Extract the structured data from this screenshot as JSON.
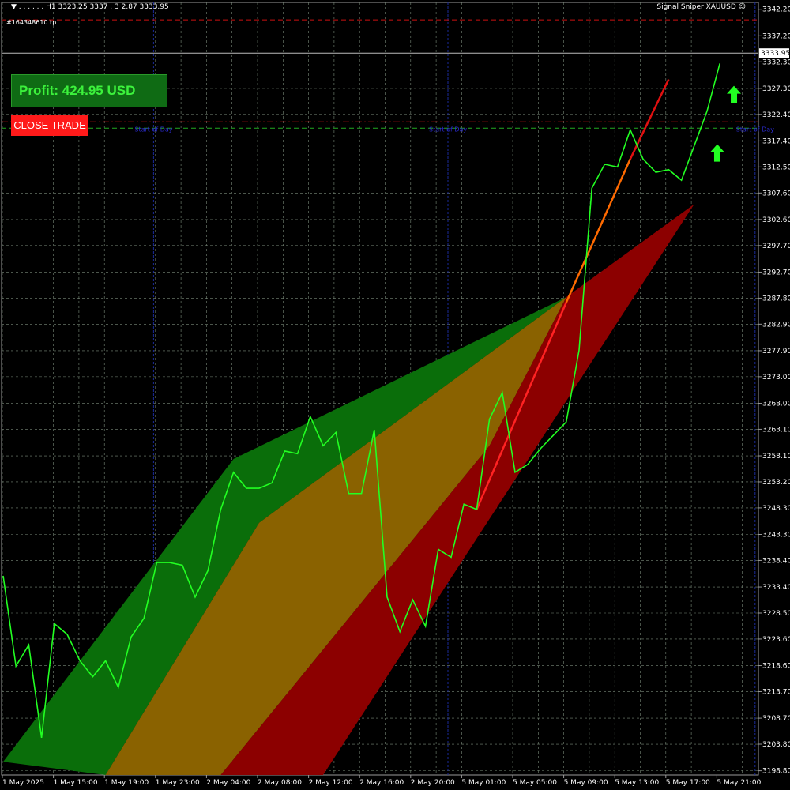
{
  "header": {
    "left": "▼  . . . . . . H1  3323.25 3337 . 3  2.87 3333.95",
    "right": "Signal Sniper XAUUSD ☺"
  },
  "order_label": "#164348610 tp",
  "profit": {
    "label": "Profit: 424.95 USD"
  },
  "close_button": {
    "label": "CLOSE TRADE"
  },
  "current_price": "3333.95",
  "start_of_day_label": "Start of Day",
  "colors": {
    "price_line": "#22ff22",
    "band_green": "#0a6e0a",
    "band_orange": "#8a6200",
    "band_red": "#8c0000",
    "signal_arrow": "#22ff22",
    "tp_line": "#cc1111",
    "grid": "#7a8a7a"
  },
  "chart_data": {
    "type": "line",
    "symbol": "XAUUSD",
    "timeframe": "H1",
    "x_ticks": [
      "1 May 2025",
      "1 May 15:00",
      "1 May 19:00",
      "1 May 23:00",
      "2 May 04:00",
      "2 May 08:00",
      "2 May 12:00",
      "2 May 16:00",
      "2 May 20:00",
      "5 May 01:00",
      "5 May 05:00",
      "5 May 09:00",
      "5 May 13:00",
      "5 May 17:00",
      "5 May 21:00"
    ],
    "y_ticks": [
      "3342.20",
      "3337.20",
      "3332.30",
      "3327.30",
      "3322.40",
      "3317.40",
      "3312.50",
      "3307.60",
      "3302.60",
      "3297.70",
      "3292.70",
      "3287.80",
      "3282.90",
      "3277.90",
      "3273.00",
      "3268.00",
      "3263.10",
      "3258.10",
      "3253.20",
      "3248.30",
      "3243.30",
      "3238.40",
      "3233.40",
      "3228.50",
      "3223.60",
      "3218.60",
      "3213.70",
      "3208.70",
      "3203.80",
      "3198.80"
    ],
    "ylim": [
      3198.0,
      3343.5
    ],
    "bar_count": 58,
    "price_series": {
      "name": "",
      "points": [
        [
          0,
          3235.5
        ],
        [
          1,
          3218.5
        ],
        [
          2,
          3222.5
        ],
        [
          3,
          3205.0
        ],
        [
          4,
          3226.5
        ],
        [
          5,
          3224.5
        ],
        [
          6,
          3219.5
        ],
        [
          7,
          3216.5
        ],
        [
          8,
          3219.5
        ],
        [
          9,
          3214.5
        ],
        [
          10,
          3224.0
        ],
        [
          11,
          3227.5
        ],
        [
          12,
          3238.0
        ],
        [
          13,
          3238.0
        ],
        [
          14,
          3237.5
        ],
        [
          15,
          3231.5
        ],
        [
          16,
          3236.5
        ],
        [
          17,
          3248.0
        ],
        [
          18,
          3255.0
        ],
        [
          19,
          3252.0
        ],
        [
          20,
          3252.0
        ],
        [
          21,
          3253.0
        ],
        [
          22,
          3259.0
        ],
        [
          23,
          3258.5
        ],
        [
          24,
          3265.5
        ],
        [
          25,
          3260.0
        ],
        [
          26,
          3262.5
        ],
        [
          27,
          3251.0
        ],
        [
          28,
          3251.0
        ],
        [
          29,
          3263.0
        ],
        [
          30,
          3231.5
        ],
        [
          31,
          3225.0
        ],
        [
          32,
          3231.0
        ],
        [
          33,
          3226.0
        ],
        [
          34,
          3240.5
        ],
        [
          35,
          3239.0
        ],
        [
          36,
          3249.0
        ],
        [
          37,
          3248.0
        ],
        [
          38,
          3265.0
        ],
        [
          39,
          3270.0
        ],
        [
          40,
          3255.0
        ],
        [
          41,
          3256.5
        ],
        [
          42,
          3259.5
        ],
        [
          43,
          3262.0
        ],
        [
          44,
          3264.5
        ],
        [
          45,
          3278.0
        ],
        [
          46,
          3308.5
        ],
        [
          47,
          3313.0
        ],
        [
          48,
          3312.5
        ],
        [
          49,
          3319.5
        ],
        [
          50,
          3314.0
        ],
        [
          51,
          3311.5
        ],
        [
          52,
          3312.0
        ],
        [
          53,
          3310.0
        ],
        [
          54,
          3316.5
        ],
        [
          55,
          3323.0
        ],
        [
          56,
          3332.0
        ]
      ]
    },
    "bands": [
      {
        "name": "",
        "color": "band_green",
        "upper": [
          [
            0,
            3200.5
          ],
          [
            18,
            3257.5
          ],
          [
            44,
            3288.0
          ],
          [
            55,
            3323.5
          ]
        ],
        "lower": [
          [
            8,
            3198.0
          ],
          [
            20,
            3245.5
          ],
          [
            44,
            3288.0
          ],
          [
            55,
            3323.5
          ]
        ]
      },
      {
        "name": "",
        "color": "band_orange",
        "upper": [
          [
            8,
            3198.0
          ],
          [
            20,
            3245.5
          ],
          [
            44,
            3288.0
          ]
        ],
        "lower": [
          [
            17,
            3198.0
          ],
          [
            38,
            3260.0
          ],
          [
            44,
            3288.0
          ]
        ]
      },
      {
        "name": "",
        "color": "band_red",
        "upper": [
          [
            17,
            3198.0
          ],
          [
            38,
            3260.0
          ],
          [
            44,
            3288.0
          ],
          [
            54,
            3305.5
          ]
        ],
        "lower": [
          [
            25,
            3198.0
          ],
          [
            32,
            3224.0
          ],
          [
            54,
            3305.5
          ]
        ]
      }
    ],
    "trend_lines": [
      {
        "name": "",
        "color": "#ff6a00",
        "points": [
          [
            44,
            3287.0
          ],
          [
            49,
            3314.0
          ]
        ]
      },
      {
        "name": "",
        "color": "#e01010",
        "points": [
          [
            49,
            3314.0
          ],
          [
            52,
            3329.0
          ]
        ]
      },
      {
        "name": "",
        "color": "#ff2222",
        "points": [
          [
            37,
            3248.0
          ],
          [
            44,
            3287.0
          ]
        ]
      }
    ],
    "signals": [
      {
        "type": "buy",
        "x": 55.8,
        "y": 3315.0
      },
      {
        "type": "buy",
        "x": 57.1,
        "y": 3326.0
      }
    ],
    "levels": [
      {
        "name": "tp",
        "price": 3340.2,
        "color": "#cc1111",
        "style": "dashed"
      },
      {
        "name": "current",
        "price": 3333.95,
        "color": "#bbbbbb",
        "style": "solid"
      },
      {
        "name": "level",
        "price": 3321.0,
        "color": "#cc1111",
        "style": "dashdot"
      },
      {
        "name": "level",
        "price": 3319.8,
        "color": "#22aa22",
        "style": "dashed"
      }
    ],
    "day_separators": [
      12,
      35,
      59
    ],
    "grid": true
  }
}
